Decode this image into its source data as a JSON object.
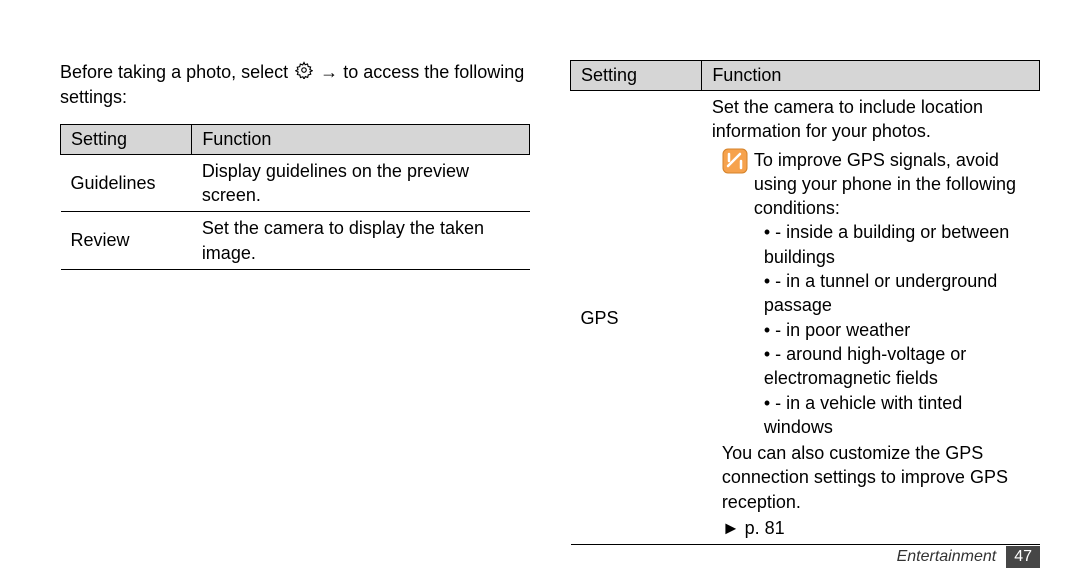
{
  "intro_before": "Before taking a photo, select ",
  "intro_arrow": " → ",
  "intro_after": " to access the following settings:",
  "table1": {
    "h1": "Setting",
    "h2": "Function",
    "rows": [
      {
        "setting": "Guidelines",
        "func": "Display guidelines on the preview screen."
      },
      {
        "setting": "Review",
        "func": "Set the camera to display the taken image."
      }
    ]
  },
  "table2": {
    "h1": "Setting",
    "h2": "Function"
  },
  "gps": {
    "setting": "GPS",
    "func_intro": "Set the camera to include location information for your photos.",
    "note_intro": "To improve GPS signals, avoid using your phone in the following conditions:",
    "bullets": [
      "inside a building or between buildings",
      "in a tunnel or underground passage",
      "in poor weather",
      "around high-voltage or electromagnetic fields",
      "in a vehicle with tinted windows"
    ],
    "customize": "You can also customize the GPS connection settings to improve GPS reception.",
    "pageref": "► p. 81"
  },
  "footer": {
    "section": "Entertainment",
    "page": "47"
  }
}
